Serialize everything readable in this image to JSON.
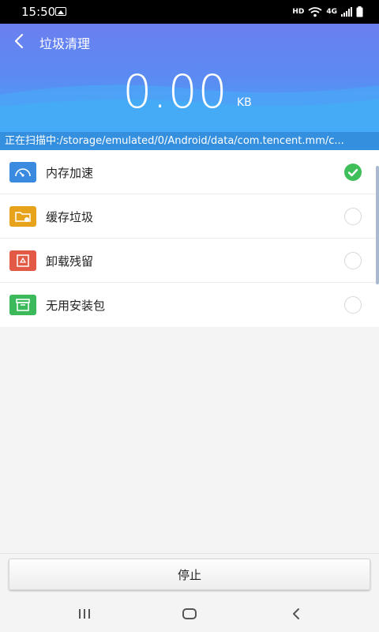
{
  "status_bar": {
    "time": "15:50",
    "hd_label": "HD",
    "network_label": "4G"
  },
  "header": {
    "title": "垃圾清理",
    "size_value": "0.00",
    "size_unit": "KB",
    "scan_path": "正在扫描中:/storage/emulated/0/Android/data/com.tencent.mm/c..."
  },
  "items": [
    {
      "label": "内存加速",
      "icon": "speedometer-icon",
      "color": "#3a8be0",
      "checked": true
    },
    {
      "label": "缓存垃圾",
      "icon": "folder-icon",
      "color": "#e8a31c",
      "checked": false
    },
    {
      "label": "卸载残留",
      "icon": "recycle-icon",
      "color": "#e25a45",
      "checked": false
    },
    {
      "label": "无用安装包",
      "icon": "apk-box-icon",
      "color": "#3cb95a",
      "checked": false
    }
  ],
  "stop_button": {
    "label": "停止"
  },
  "colors": {
    "header_top": "#6b7ff0",
    "header_bottom": "#45acf8",
    "check_green": "#3fbf5a"
  }
}
